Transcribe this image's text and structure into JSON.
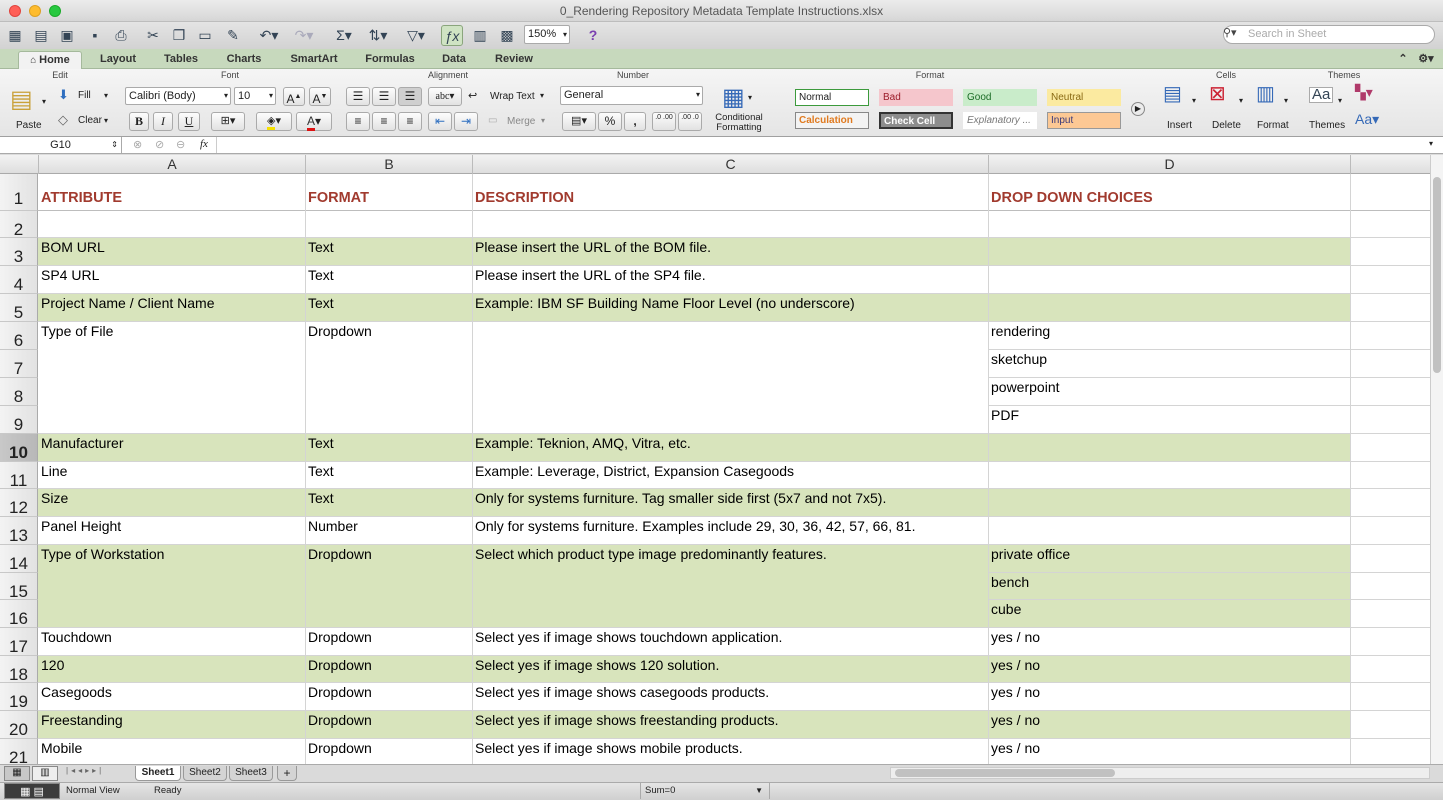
{
  "window": {
    "title": "0_Rendering Repository Metadata Template Instructions.xlsx"
  },
  "toolbar": {
    "zoom": "150%",
    "search_placeholder": "Search in Sheet"
  },
  "ribbon_tabs": [
    "Home",
    "Layout",
    "Tables",
    "Charts",
    "SmartArt",
    "Formulas",
    "Data",
    "Review"
  ],
  "ribbon": {
    "groups": {
      "edit": "Edit",
      "font": "Font",
      "alignment": "Alignment",
      "number": "Number",
      "format": "Format",
      "cells": "Cells",
      "themes": "Themes"
    },
    "paste": "Paste",
    "fill": "Fill",
    "clear": "Clear",
    "font_name": "Calibri (Body)",
    "font_size": "10",
    "bold": "B",
    "italic": "I",
    "underline": "U",
    "wrap_text": "Wrap Text",
    "merge": "Merge",
    "abc": "abc",
    "number_format": "General",
    "percent": "%",
    "comma": ",",
    "dec_inc": ".0 .00",
    "dec_dec": ".00 .0",
    "conditional_formatting": [
      "Conditional",
      "Formatting"
    ],
    "styles": [
      {
        "label": "Normal",
        "bg": "#ffffff",
        "fg": "#222222",
        "border": "#3c9a3c"
      },
      {
        "label": "Bad",
        "bg": "#f5c6cc",
        "fg": "#9c1c2a",
        "border": "#f5c6cc"
      },
      {
        "label": "Good",
        "bg": "#c9ecca",
        "fg": "#1b6b26",
        "border": "#c9ecca"
      },
      {
        "label": "Neutral",
        "bg": "#fbeaa0",
        "fg": "#8a6a14",
        "border": "#fbeaa0"
      },
      {
        "label": "Calculation",
        "bg": "#f3f3f3",
        "fg": "#e07a1f",
        "border": "#888888"
      },
      {
        "label": "Check Cell",
        "bg": "#8d8d8d",
        "fg": "#ffffff",
        "border": "#333333"
      },
      {
        "label": "Explanatory ...",
        "bg": "#ffffff",
        "fg": "#777777",
        "border": "#ffffff"
      },
      {
        "label": "Input",
        "bg": "#fcc894",
        "fg": "#3a3a7a",
        "border": "#999999"
      }
    ],
    "insert": "Insert",
    "delete": "Delete",
    "format_btn": "Format",
    "themes_btn": "Themes",
    "aa": "Aa"
  },
  "formula_bar": {
    "cell_ref": "G10",
    "fx": "fx",
    "value": ""
  },
  "columns": [
    "A",
    "B",
    "C",
    "D"
  ],
  "rows": [
    {
      "n": "1",
      "a": "ATTRIBUTE",
      "b": "FORMAT",
      "c": "DESCRIPTION",
      "d": "DROP DOWN CHOICES"
    },
    {
      "n": "2",
      "a": "",
      "b": "",
      "c": "",
      "d": ""
    },
    {
      "n": "3",
      "a": "BOM URL",
      "b": "Text",
      "c": "Please insert the URL of the BOM file.",
      "d": ""
    },
    {
      "n": "4",
      "a": "SP4 URL",
      "b": "Text",
      "c": "Please insert the URL of the SP4 file.",
      "d": ""
    },
    {
      "n": "5",
      "a": "Project Name / Client Name",
      "b": "Text",
      "c": "Example: IBM SF Building Name Floor Level (no underscore)",
      "d": ""
    },
    {
      "n": "6",
      "a": "Type of File",
      "b": "Dropdown",
      "c": "",
      "d": "rendering"
    },
    {
      "n": "7",
      "a": "",
      "b": "",
      "c": "",
      "d": "sketchup"
    },
    {
      "n": "8",
      "a": "",
      "b": "",
      "c": "",
      "d": "powerpoint"
    },
    {
      "n": "9",
      "a": "",
      "b": "",
      "c": "",
      "d": "PDF"
    },
    {
      "n": "10",
      "a": "Manufacturer",
      "b": "Text",
      "c": "Example: Teknion, AMQ, Vitra, etc.",
      "d": ""
    },
    {
      "n": "11",
      "a": "Line",
      "b": "Text",
      "c": "Example: Leverage, District, Expansion Casegoods",
      "d": ""
    },
    {
      "n": "12",
      "a": "Size",
      "b": "Text",
      "c": "Only for systems furniture. Tag smaller side first (5x7 and not 7x5).",
      "d": ""
    },
    {
      "n": "13",
      "a": "Panel Height",
      "b": "Number",
      "c": "Only for systems furniture. Examples include 29, 30, 36, 42, 57, 66, 81.",
      "d": ""
    },
    {
      "n": "14",
      "a": "Type of Workstation",
      "b": "Dropdown",
      "c": "Select which product type image predominantly features.",
      "d": "private office"
    },
    {
      "n": "15",
      "a": "",
      "b": "",
      "c": "",
      "d": "bench"
    },
    {
      "n": "16",
      "a": "",
      "b": "",
      "c": "",
      "d": "cube"
    },
    {
      "n": "17",
      "a": "Touchdown",
      "b": "Dropdown",
      "c": "Select yes if image shows touchdown application.",
      "d": "yes / no"
    },
    {
      "n": "18",
      "a": "120",
      "b": "Dropdown",
      "c": "Select yes if image shows 120 solution.",
      "d": "yes / no"
    },
    {
      "n": "19",
      "a": "Casegoods",
      "b": "Dropdown",
      "c": "Select yes if image shows casegoods products.",
      "d": "yes / no"
    },
    {
      "n": "20",
      "a": "Freestanding",
      "b": "Dropdown",
      "c": "Select yes if image shows freestanding products.",
      "d": "yes / no"
    },
    {
      "n": "21",
      "a": "Mobile",
      "b": "Dropdown",
      "c": "Select yes if image shows mobile products.",
      "d": "yes / no"
    }
  ],
  "sheets": [
    "Sheet1",
    "Sheet2",
    "Sheet3"
  ],
  "add_sheet": "+",
  "status": {
    "view": "Normal View",
    "ready": "Ready",
    "sum": "Sum=0"
  },
  "colors": {
    "band": "#d8e4bc",
    "header_text": "#a13a2e",
    "ribbon_tab_bar": "#c7d9bd"
  }
}
